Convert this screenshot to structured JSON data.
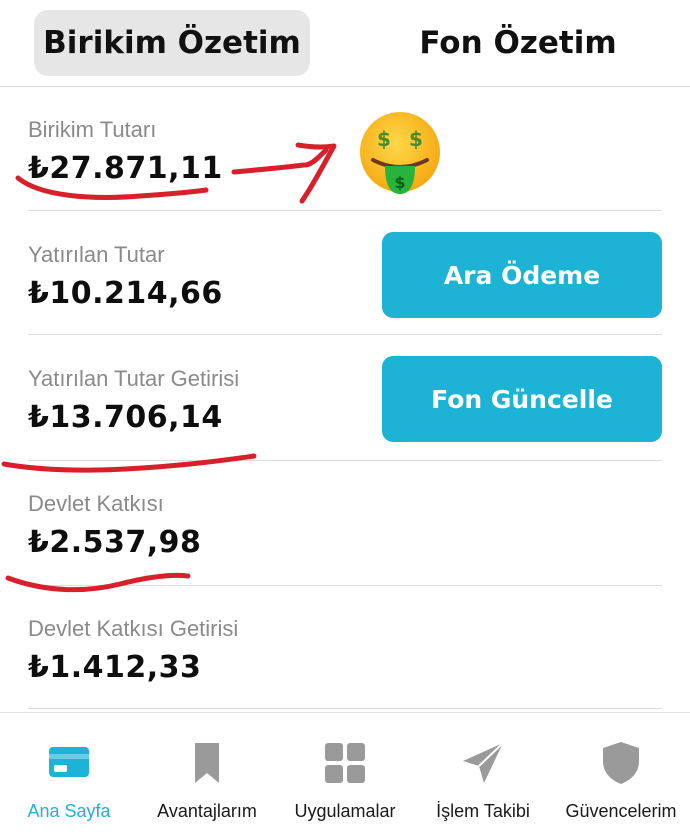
{
  "tabs": {
    "savings_summary": "Birikim Özetim",
    "fund_summary": "Fon Özetim",
    "active": "savings_summary"
  },
  "rows": [
    {
      "label": "Birikim Tutarı",
      "value": "₺27.871,11"
    },
    {
      "label": "Yatırılan Tutar",
      "value": "₺10.214,66"
    },
    {
      "label": "Yatırılan Tutar Getirisi",
      "value": "₺13.706,14"
    },
    {
      "label": "Devlet Katkısı",
      "value": "₺2.537,98"
    },
    {
      "label": "Devlet Katkısı Getirisi",
      "value": "₺1.412,33"
    }
  ],
  "buttons": {
    "interim_payment": "Ara Ödeme",
    "update_fund": "Fon Güncelle"
  },
  "decorations": {
    "emoji": "money-mouth-face-icon",
    "annotation_color": "#d8202b"
  },
  "nav": {
    "items": [
      {
        "label": "Ana Sayfa",
        "icon": "card-icon",
        "active": true
      },
      {
        "label": "Avantajlarım",
        "icon": "bookmark-icon",
        "active": false
      },
      {
        "label": "Uygulamalar",
        "icon": "grid-icon",
        "active": false
      },
      {
        "label": "İşlem Takibi",
        "icon": "paper-plane-icon",
        "active": false
      },
      {
        "label": "Güvencelerim",
        "icon": "shield-icon",
        "active": false
      }
    ]
  },
  "colors": {
    "accent": "#1cb3d4",
    "inactive_icon": "#9a9a9a",
    "label_gray": "#8a8a8a"
  }
}
